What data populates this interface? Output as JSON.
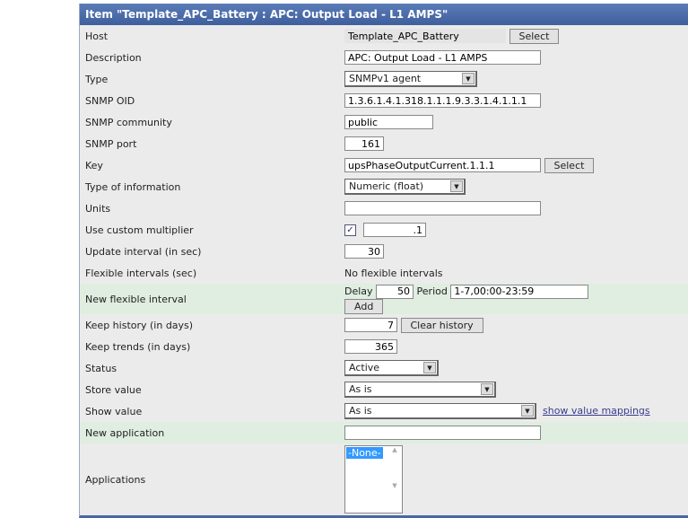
{
  "title": "Item \"Template_APC_Battery : APC: Output Load - L1 AMPS\"",
  "rows": {
    "host": {
      "label": "Host",
      "value": "Template_APC_Battery",
      "button": "Select"
    },
    "description": {
      "label": "Description",
      "value": "APC: Output Load - L1 AMPS"
    },
    "type": {
      "label": "Type",
      "value": "SNMPv1 agent"
    },
    "oid": {
      "label": "SNMP OID",
      "value": "1.3.6.1.4.1.318.1.1.1.9.3.3.1.4.1.1.1"
    },
    "community": {
      "label": "SNMP community",
      "value": "public"
    },
    "port": {
      "label": "SNMP port",
      "value": "161"
    },
    "key": {
      "label": "Key",
      "value": "upsPhaseOutputCurrent.1.1.1",
      "button": "Select"
    },
    "info": {
      "label": "Type of information",
      "value": "Numeric (float)"
    },
    "units": {
      "label": "Units",
      "value": ""
    },
    "multiplier": {
      "label": "Use custom multiplier",
      "checked": "✓",
      "value": ".1"
    },
    "interval": {
      "label": "Update interval (in sec)",
      "value": "30"
    },
    "flex": {
      "label": "Flexible intervals (sec)",
      "value": "No flexible intervals"
    },
    "newflex": {
      "label": "New flexible interval",
      "delay_label": "Delay",
      "delay": "50",
      "period_label": "Period",
      "period": "1-7,00:00-23:59",
      "button": "Add"
    },
    "history": {
      "label": "Keep history (in days)",
      "value": "7",
      "button": "Clear history"
    },
    "trends": {
      "label": "Keep trends (in days)",
      "value": "365"
    },
    "status": {
      "label": "Status",
      "value": "Active"
    },
    "store": {
      "label": "Store value",
      "value": "As is"
    },
    "show": {
      "label": "Show value",
      "value": "As is",
      "link": "show value mappings"
    },
    "newapp": {
      "label": "New application",
      "value": ""
    },
    "apps": {
      "label": "Applications",
      "options": [
        "-None-"
      ]
    }
  }
}
